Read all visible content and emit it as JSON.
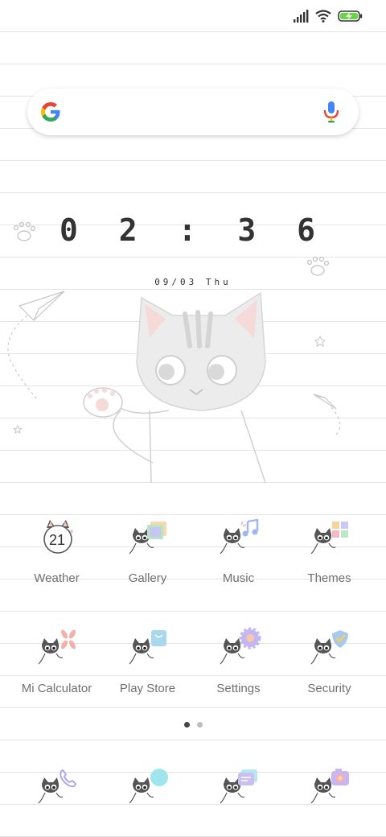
{
  "status_bar": {
    "icons": [
      "signal-icon",
      "wifi-icon",
      "battery-charging-icon"
    ],
    "battery_color": "#6ad34a"
  },
  "search": {
    "logo": "google-g-icon",
    "mic": "microphone-icon"
  },
  "clock": {
    "time": "0 2 : 3 6",
    "date": "09/03 Thu"
  },
  "apps_row1": [
    {
      "label": "Weather",
      "icon": "weather-icon",
      "badge": "21"
    },
    {
      "label": "Gallery",
      "icon": "gallery-icon"
    },
    {
      "label": "Music",
      "icon": "music-icon"
    },
    {
      "label": "Themes",
      "icon": "themes-icon"
    }
  ],
  "apps_row2": [
    {
      "label": "Mi Calculator",
      "icon": "calculator-icon"
    },
    {
      "label": "Play Store",
      "icon": "play-store-icon"
    },
    {
      "label": "Settings",
      "icon": "settings-icon"
    },
    {
      "label": "Security",
      "icon": "security-icon"
    }
  ],
  "dock": [
    {
      "icon": "phone-icon"
    },
    {
      "icon": "browser-icon"
    },
    {
      "icon": "messages-icon"
    },
    {
      "icon": "camera-icon"
    }
  ],
  "page_indicator": {
    "pages": 2,
    "active": 0
  }
}
